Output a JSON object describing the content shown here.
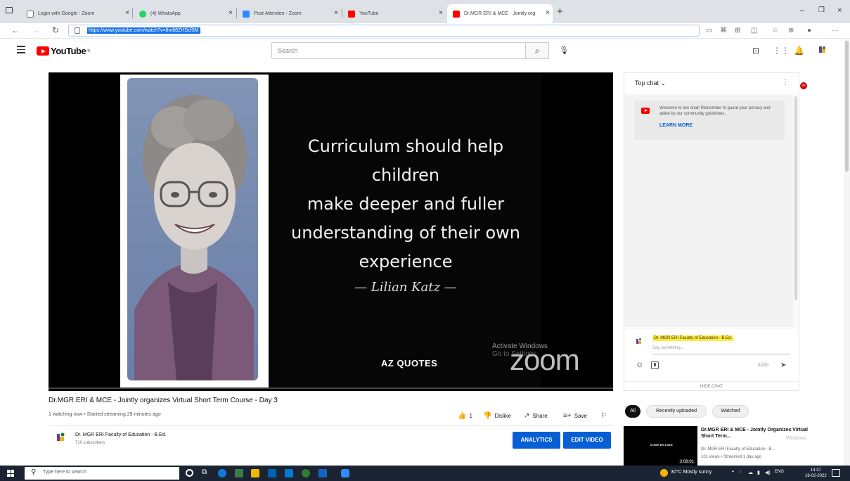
{
  "browser": {
    "tabs": [
      {
        "title": "Login with Google - Zoom",
        "active": false
      },
      {
        "title": "(4) WhatsApp",
        "active": false
      },
      {
        "title": "Post Attendee - Zoom",
        "active": false
      },
      {
        "title": "YouTube",
        "active": false
      },
      {
        "title": "Dr.MGR ERI & MCE - Jointly org",
        "active": true
      }
    ],
    "url": "https://www.youtube.com/watch?v=8m88ZHDcf9M"
  },
  "youtube": {
    "logo_text": "YouTube",
    "logo_region": "IN",
    "search_placeholder": "Search",
    "notification_count": "9+"
  },
  "video": {
    "quote_lines": [
      "Curriculum should help children",
      "make deeper and fuller",
      "understanding of their own",
      "experience"
    ],
    "author": "— Lilian Katz —",
    "brand": "AZ QUOTES",
    "overlay_activate": "Activate Windows",
    "overlay_goto": "Go to Settings",
    "zoom_watermark": "zoom",
    "title": "Dr.MGR ERI & MCE - Jointly organizes Virtual Short Term Course - Day 3",
    "meta": "1 watching now • Started streaming 29 minutes ago",
    "like_count": "1",
    "dislike_label": "Dislike",
    "share_label": "Share",
    "save_label": "Save"
  },
  "channel": {
    "name": "Dr. MGR ERI Faculty of Education - B.Ed.",
    "subscribers": "710 subscribers",
    "analytics_label": "ANALYTICS",
    "edit_label": "EDIT VIDEO"
  },
  "chat": {
    "header": "Top chat",
    "welcome_text": "Welcome to live chat! Remember to guard your privacy and abide by our community guidelines.",
    "learn_more": "LEARN MORE",
    "user_name": "Dr. MGR ERI Faculty of Education - B.Ed.",
    "input_placeholder": "Say something...",
    "char_count": "0/200",
    "hide_label": "HIDE CHAT"
  },
  "chips": [
    "All",
    "Recently uploaded",
    "Watched"
  ],
  "related": {
    "title": "Dr.MGR ERI & MCE - Jointly Organizes Virtual Short Term...",
    "channel": "Dr. MGR ERI Faculty of Education - B...",
    "views": "101 views • Streamed 1 day ago",
    "duration": "2:08:01",
    "thumb_label": "Dr.MGR ERI & MCE",
    "windows_mark": "Windows"
  },
  "taskbar": {
    "search_placeholder": "Type here to search",
    "weather": "30°C  Mostly sunny",
    "lang": "ENG",
    "time": "14:37",
    "date": "16-02-2022"
  },
  "colors": {
    "youtube_red": "#ff0000",
    "button_blue": "#065fd4",
    "taskbar": "#1c2433"
  }
}
